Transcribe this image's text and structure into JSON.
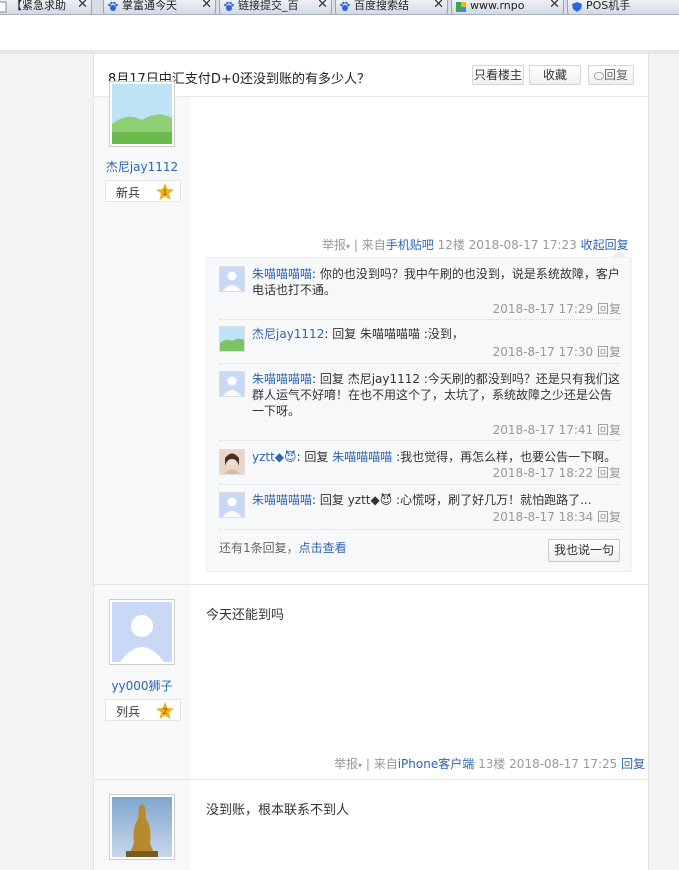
{
  "browser": {
    "tabs": [
      {
        "label": "【紧急求助",
        "icon": "page-icon"
      },
      {
        "label": "掌富通今天",
        "icon": "paw-icon"
      },
      {
        "label": "链接提交_百",
        "icon": "paw-icon"
      },
      {
        "label": "百度搜索结",
        "icon": "paw-icon"
      },
      {
        "label": "www.rnpo",
        "icon": "colorful-icon"
      },
      {
        "label": "POS机手",
        "icon": "shield-icon"
      }
    ],
    "close_glyph": "✕"
  },
  "thread": {
    "title": "8月17日中汇支付D+0还没到账的有多少人？",
    "only_op_label": "只看楼主",
    "favorite_label": "收藏",
    "reply_label": "回复"
  },
  "post1": {
    "username": "杰尼jay1112",
    "rank": "新兵",
    "rank_level": "1",
    "report_label": "举报",
    "source_prefix": "| 来自",
    "source": "手机贴吧",
    "floor": "12楼",
    "time": "2018-08-17 17:23",
    "collapse_label": "收起回复",
    "replies": [
      {
        "name": "朱喵喵喵喵",
        "text": ": 你的也没到吗？我中午刷的也没到，说是系统故障，客户电话也打不通。",
        "time": "2018-8-17 17:29",
        "reply_label": "回复"
      },
      {
        "name": "杰尼jay1112",
        "text": ": 回复 朱喵喵喵喵 :没到，",
        "time": "2018-8-17 17:30",
        "reply_label": "回复"
      },
      {
        "name": "朱喵喵喵喵",
        "text": ": 回复 杰尼jay1112 :今天刷的都没到吗？还是只有我们这群人运气不好唷！在也不用这个了，太坑了，系统故障之少还是公告一下呀。",
        "time": "2018-8-17 17:41",
        "reply_label": "回复"
      },
      {
        "name": "yztt◆😈",
        "text_prefix": ": 回复 ",
        "text_link": "朱喵喵喵喵",
        "text": " :我也觉得，再怎么样，也要公告一下啊。",
        "time": "2018-8-17 18:22",
        "reply_label": "回复"
      },
      {
        "name": "朱喵喵喵喵",
        "text": ": 回复 yztt◆😈 :心慌呀，刷了好几万！就怕跑路了...",
        "time": "2018-8-17 18:34",
        "reply_label": "回复"
      }
    ],
    "more_prefix": "还有1条回复，",
    "more_link": "点击查看",
    "say_label": "我也说一句"
  },
  "post2": {
    "username": "yy000狮子",
    "rank": "列兵",
    "rank_level": "2",
    "content": "今天还能到吗",
    "report_label": "举报",
    "source_prefix": "| 来自",
    "source": "iPhone客户端",
    "floor": "13楼",
    "time": "2018-08-17 17:25",
    "reply_label": "回复"
  },
  "post3": {
    "content": "没到账，根本联系不到人"
  },
  "colors": {
    "link": "#2d64b3",
    "meta": "#999999",
    "badge": "#f3b21a"
  }
}
